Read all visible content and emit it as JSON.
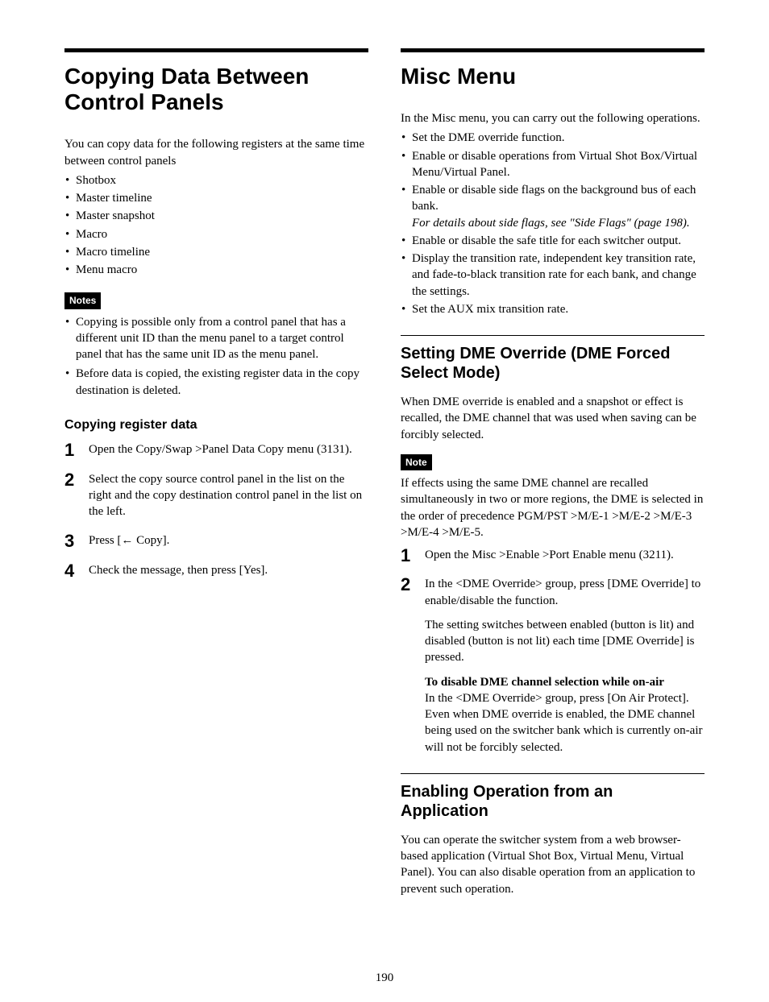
{
  "page_number": "190",
  "left": {
    "heading": "Copying Data Between Control Panels",
    "intro": "You can copy data for the following registers at the same time between control panels",
    "register_list": [
      "Shotbox",
      "Master timeline",
      "Master snapshot",
      "Macro",
      "Macro timeline",
      "Menu macro"
    ],
    "notes_label": "Notes",
    "notes": [
      "Copying is possible only from a control panel that has a different unit ID than the menu panel to a target control panel that has the same unit ID as the menu panel.",
      "Before data is copied, the existing register data in the copy destination is deleted."
    ],
    "sub_heading": "Copying register data",
    "steps": [
      "Open the Copy/Swap >Panel Data Copy menu (3131).",
      "Select the copy source control panel in the list on the right and the copy destination control panel in the list on the left.",
      "Press [← Copy].",
      "Check the message, then press [Yes]."
    ]
  },
  "right": {
    "heading": "Misc Menu",
    "intro": "In the Misc menu, you can carry out the following operations.",
    "ops": [
      {
        "text": "Set the DME override function."
      },
      {
        "text": "Enable or disable operations from Virtual Shot Box/Virtual Menu/Virtual Panel."
      },
      {
        "text": "Enable or disable side flags on the background bus of each bank.",
        "italic": "For details about side flags, see \"Side Flags\" (page 198)."
      },
      {
        "text": "Enable or disable the safe title for each switcher output."
      },
      {
        "text": "Display the transition rate, independent key transition rate, and fade-to-black transition rate for each bank, and change the settings."
      },
      {
        "text": "Set the AUX mix transition rate."
      }
    ],
    "section1": {
      "heading": "Setting DME Override (DME Forced Select Mode)",
      "para": "When DME override is enabled and a snapshot or effect is recalled, the DME channel that was used when saving can be forcibly selected.",
      "note_label": "Note",
      "note_text": "If effects using the same DME channel are recalled simultaneously in two or more regions, the DME is selected in the order of precedence PGM/PST >M/E-1 >M/E-2 >M/E-3 >M/E-4 >M/E-5.",
      "steps": [
        {
          "text": "Open the Misc >Enable >Port Enable menu (3211)."
        },
        {
          "text": "In the <DME Override> group, press [DME Override] to enable/disable the function.",
          "para2": "The setting switches between enabled (button is lit) and disabled (button is not lit) each time [DME Override] is pressed.",
          "bold_heading": "To disable DME channel selection while on-air",
          "para3": "In the <DME Override> group, press [On Air Protect]. Even when DME override is enabled, the DME channel being used on the switcher bank which is currently on-air will not be forcibly selected."
        }
      ]
    },
    "section2": {
      "heading": "Enabling Operation from an Application",
      "para": "You can operate the switcher system from a web browser-based application (Virtual Shot Box, Virtual Menu, Virtual Panel). You can also disable operation from an application to prevent such operation."
    }
  }
}
